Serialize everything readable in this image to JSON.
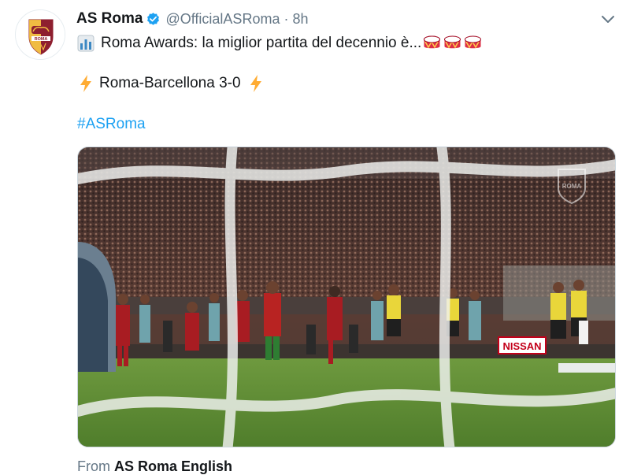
{
  "tweet": {
    "author_name": "AS Roma",
    "author_handle": "@OfficialASRoma",
    "separator": "·",
    "timestamp": "8h",
    "line1_text": "Roma Awards: la miglior partita del decennio è...",
    "line2_text": "Roma-Barcellona 3-0",
    "hashtag": "#ASRoma",
    "icons": {
      "avatar": "as-roma-crest-icon",
      "verified": "verified-badge-icon",
      "caret": "chevron-down-icon",
      "chart": "bar-chart-emoji-icon",
      "drum": "drum-emoji-icon",
      "bolt": "lightning-emoji-icon"
    }
  },
  "media": {
    "type": "video-still",
    "watermark": "ROMA",
    "board_text": "NISSAN"
  },
  "quoted_source": {
    "prefix": "From",
    "account": "AS Roma English"
  },
  "colors": {
    "link": "#1da1f2",
    "secondary_text": "#657786",
    "roma_red": "#8e1f2f",
    "roma_yellow": "#f0bc42"
  }
}
